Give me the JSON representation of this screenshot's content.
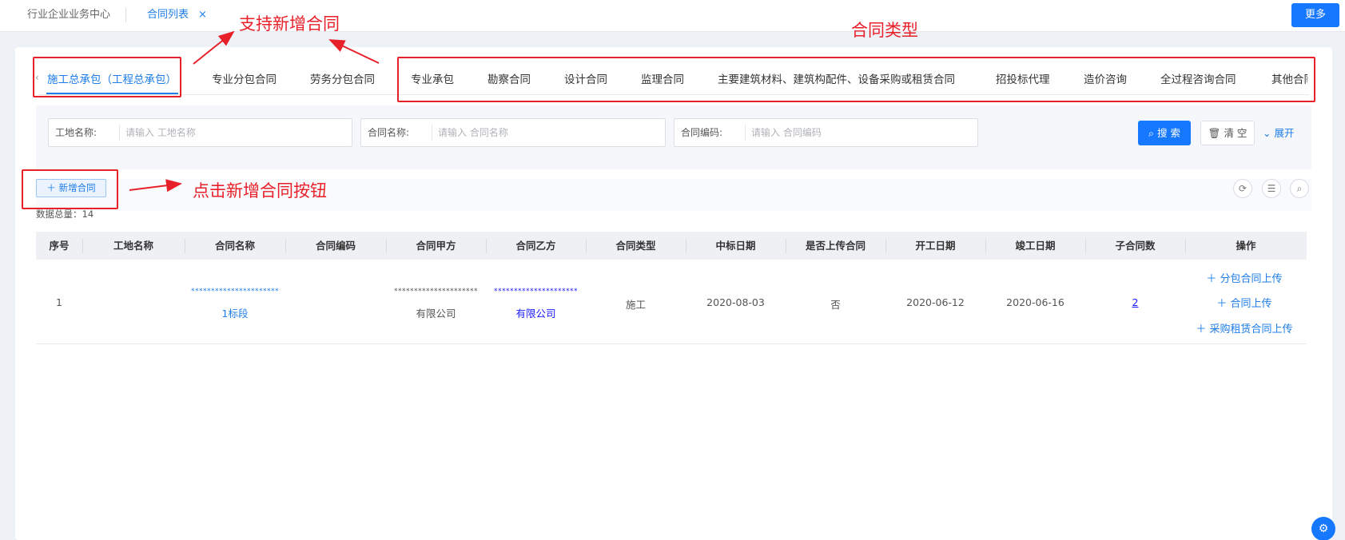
{
  "topbar": {
    "tab_home": "行业企业业务中心",
    "tab_contracts": "合同列表",
    "tab_close": "×",
    "more_label": "更多"
  },
  "contract_types": {
    "prev_arrow": "‹",
    "next_arrow": "›",
    "items": [
      "施工总承包（工程总承包）",
      "专业分包合同",
      "劳务分包合同",
      "专业承包",
      "勘察合同",
      "设计合同",
      "监理合同",
      "主要建筑材料、建筑构配件、设备采购或租赁合同",
      "招投标代理",
      "造价咨询",
      "全过程咨询合同",
      "其他合同"
    ]
  },
  "search": {
    "site_label": "工地名称:",
    "site_placeholder": "请输入 工地名称",
    "contract_label": "合同名称:",
    "contract_placeholder": "请输入 合同名称",
    "code_label": "合同编码:",
    "code_placeholder": "请输入 合同编码",
    "search_label": "搜 索",
    "clear_label": "清 空",
    "expand_label": "展开"
  },
  "toolbar": {
    "add_label": "＋ 新增合同",
    "total_label": "数据总量：",
    "total_value": "14"
  },
  "table": {
    "headers": [
      "序号",
      "工地名称",
      "合同名称",
      "合同编码",
      "合同甲方",
      "合同乙方",
      "合同类型",
      "中标日期",
      "是否上传合同",
      "开工日期",
      "竣工日期",
      "子合同数",
      "操作"
    ],
    "rows": [
      {
        "index": "1",
        "site": "",
        "name_mask": "**********************",
        "name_suffix": "1标段",
        "code": "",
        "party_a_mask": "*********************",
        "party_a_suffix": "有限公司",
        "party_b_mask": "*********************",
        "party_b_suffix": "有限公司",
        "type": "施工",
        "bid_date": "2020-08-03",
        "uploaded": "否",
        "start_date": "2020-06-12",
        "end_date": "2020-06-16",
        "sub_count": "2",
        "ops": [
          "＋ 分包合同上传",
          "＋ 合同上传",
          "＋ 采购租赁合同上传"
        ]
      }
    ]
  },
  "annotations": {
    "support_add": "支持新增合同",
    "contract_type": "合同类型",
    "click_add": "点击新增合同按钮"
  },
  "colors": {
    "primary": "#1677ff",
    "annotation": "#e8202a",
    "link": "#1e7de8"
  }
}
